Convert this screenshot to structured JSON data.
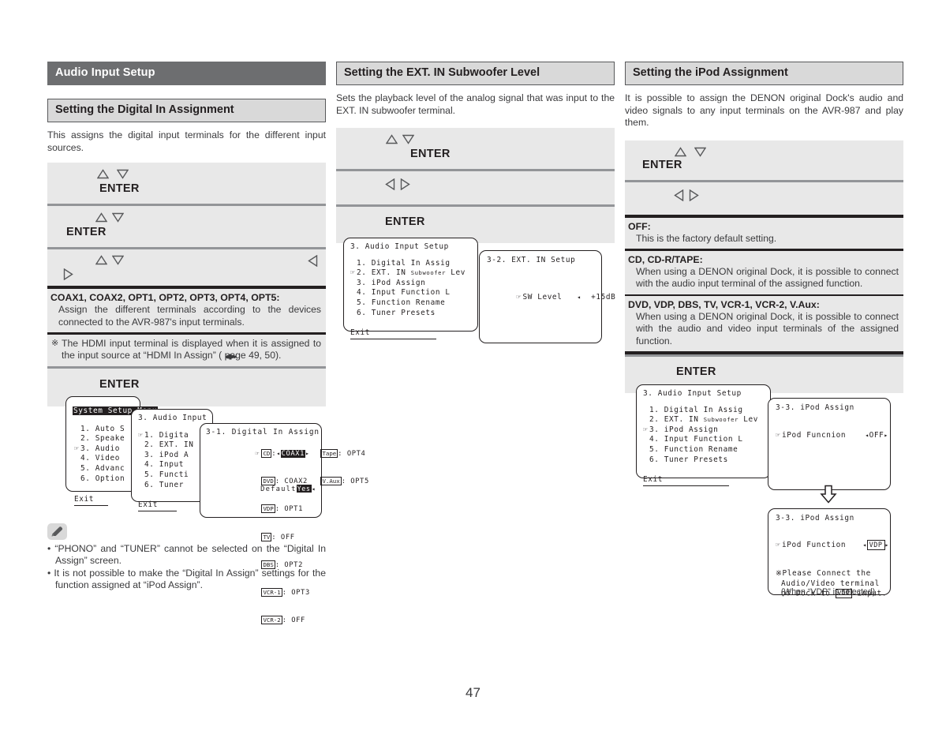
{
  "page": {
    "number": "47"
  },
  "left": {
    "chapter": "Audio Input Setup",
    "section": "Setting the Digital In Assignment",
    "intro": "This assigns the digital input terminals for the different input sources.",
    "steps": {
      "enter1": "ENTER",
      "enter2": "ENTER",
      "enter3": "ENTER"
    },
    "def": {
      "term": "COAX1, COAX2, OPT1, OPT2, OPT3, OPT4, OPT5:",
      "desc": "Assign the different terminals according to the devices connected to the AVR-987's input terminals."
    },
    "hdmi_note": "The HDMI input terminal is displayed when it is assigned to the input source at “HDMI In Assign” (        page 49, 50).",
    "hdmi_note_star": "※",
    "memo": {
      "icon": "pencil-icon",
      "bullet1": "• “PHONO” and “TUNER” cannot be selected on the “Digital In Assign” screen.",
      "bullet2": "• It is not possible to make the “Digital In Assign” settings for the function assigned at “iPod Assign”."
    },
    "lcd_system": {
      "title": "System Setup Menu",
      "items": [
        "1. Auto S",
        "2. Speake",
        "3. Audio",
        "4. Video",
        "5. Advanc",
        "6. Option"
      ],
      "cursor_index": 2,
      "exit": "Exit"
    },
    "lcd_audio": {
      "title": "3. Audio Input Setup",
      "items": [
        "1. Digita",
        "2. EXT. IN",
        "3. iPod A",
        "4. Input",
        "5. Functi",
        "6. Tuner"
      ],
      "cursor_index": 0,
      "exit": "Exit"
    },
    "lcd_digital": {
      "title": "3-1. Digital In Assign",
      "rows_left": [
        {
          "label": "CD",
          "value": "COAX1",
          "selected": true
        },
        {
          "label": "DVD",
          "value": "COAX2",
          "selected": false
        },
        {
          "label": "VDP",
          "value": "OPT1",
          "selected": false
        },
        {
          "label": "TV",
          "value": "OFF",
          "selected": false
        },
        {
          "label": "DBS",
          "value": "OPT2",
          "selected": false
        },
        {
          "label": "VCR-1",
          "value": "OPT3",
          "selected": false
        },
        {
          "label": "VCR-2",
          "value": "OFF",
          "selected": false
        }
      ],
      "rows_right": [
        {
          "label": "Tape",
          "value": "OPT4"
        },
        {
          "label": "V.Aux",
          "value": "OPT5"
        }
      ],
      "default_label": "Default",
      "default_value": "Yes"
    }
  },
  "mid": {
    "section": "Setting the EXT. IN Subwoofer Level",
    "intro": "Sets the playback level of the analog signal that was input to the EXT. IN subwoofer terminal.",
    "steps": {
      "enter1": "ENTER",
      "enter2": "ENTER"
    },
    "lcd_audio": {
      "title": "3. Audio Input Setup",
      "items": [
        "1. Digital In Assig",
        "2. EXT. IN Subwoofer Lev",
        "3. iPod Assign",
        "4. Input Function L",
        "5. Function Rename",
        "6. Tuner Presets"
      ],
      "cursor_index": 1,
      "exit": "Exit"
    },
    "lcd_ext": {
      "title": "3-2. EXT. IN Setup",
      "row_label": "SW Level",
      "row_value": "+15dB"
    }
  },
  "right": {
    "section": "Setting the iPod Assignment",
    "intro": "It is possible to assign the DENON original Dock's audio and video signals to any input terminals on the AVR-987 and play them.",
    "steps": {
      "enter1": "ENTER",
      "enter2": "ENTER"
    },
    "defs": [
      {
        "term": "OFF:",
        "desc": "This is the factory default setting."
      },
      {
        "term": "CD, CD-R/TAPE:",
        "desc": "When using a DENON original Dock, it is possible to connect with the audio input terminal of the assigned function."
      },
      {
        "term": "DVD, VDP, DBS, TV, VCR-1, VCR-2, V.Aux:",
        "desc": "When using a DENON original Dock, it is possible to connect with the audio and video input terminals of the assigned function."
      }
    ],
    "lcd_audio": {
      "title": "3. Audio Input Setup",
      "items": [
        "1. Digital In Assig",
        "2. EXT. IN Subwoofer Lev",
        "3. iPod Assign",
        "4. Input Function L",
        "5. Function Rename",
        "6. Tuner Presets"
      ],
      "cursor_index": 2,
      "exit": "Exit"
    },
    "lcd_ipod_off": {
      "title": "3-3. iPod Assign",
      "row_label": "iPod Funcnion",
      "row_value": "OFF"
    },
    "lcd_ipod_vdp": {
      "title": "3-3. iPod Assign",
      "row_label": "iPod Function",
      "row_value": "VDP",
      "note_line1": "※Please Connect the",
      "note_line2": "Audio/Video terminal",
      "note_line3a": "of Dock to",
      "note_line3b": "VDP",
      "note_line3c": "input."
    },
    "caption": "(When “VDP” is selected)"
  }
}
